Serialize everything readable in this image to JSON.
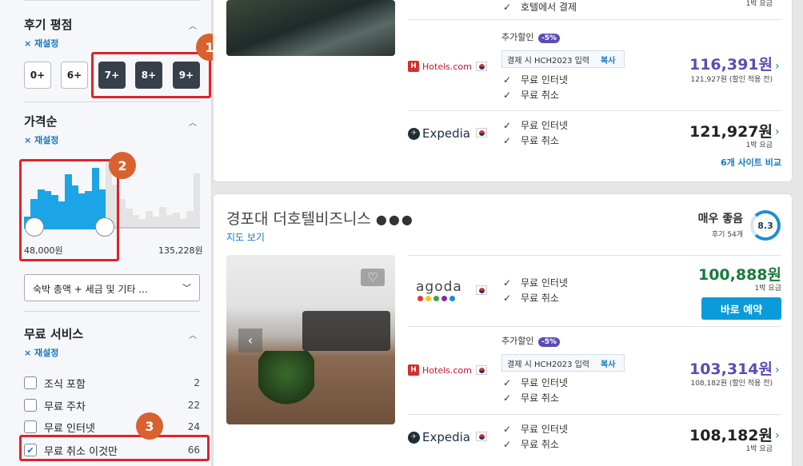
{
  "sidebar": {
    "rating": {
      "title": "후기 평점",
      "reset": "× 재설정",
      "options": [
        "0+",
        "6+",
        "7+",
        "8+",
        "9+"
      ]
    },
    "price": {
      "title": "가격순",
      "reset": "× 재설정",
      "min": "48,000원",
      "max": "135,228원",
      "select": "숙박 총액 + 세금 및 기타 ..."
    },
    "free": {
      "title": "무료 서비스",
      "reset": "× 재설정",
      "items": [
        {
          "label": "조식 포함",
          "count": "2",
          "checked": false
        },
        {
          "label": "무료 주차",
          "count": "22",
          "checked": false
        },
        {
          "label": "무료 인터넷",
          "count": "24",
          "checked": false
        },
        {
          "label": "무료 취소 이것만",
          "count": "66",
          "checked": true
        }
      ]
    }
  },
  "annotations": [
    "1",
    "2",
    "3"
  ],
  "card1": {
    "top_feature": "호텔에서 결제",
    "top_sub": "1박 요금",
    "hotels": {
      "promo": "추가할인",
      "promo_pct": "-5%",
      "coupon": "결제 시 HCH2023 입력",
      "copy": "복사",
      "features": [
        "무료 인터넷",
        "무료 취소"
      ],
      "price": "116,391원",
      "sub": "121,927원 (할인 적용 전)"
    },
    "expedia": {
      "features": [
        "무료 인터넷",
        "무료 취소"
      ],
      "price": "121,927원",
      "sub": "1박 요금"
    },
    "compare": "6개 사이트 비교"
  },
  "card2": {
    "name": "경포대 더호텔비즈니스",
    "map": "지도 보기",
    "rating_label": "매우 좋음",
    "reviews": "후기 54개",
    "score": "8.3",
    "agoda": {
      "features": [
        "무료 인터넷",
        "무료 취소"
      ],
      "price": "100,888원",
      "sub": "1박 요금",
      "book": "바로 예약"
    },
    "hotels": {
      "promo": "추가할인",
      "promo_pct": "-5%",
      "coupon": "결제 시 HCH2023 입력",
      "copy": "복사",
      "features": [
        "무료 인터넷",
        "무료 취소"
      ],
      "price": "103,314원",
      "sub": "108,182원 (할인 적용 전)"
    },
    "expedia": {
      "features": [
        "무료 인터넷",
        "무료 취소"
      ],
      "price": "108,182원",
      "sub": "1박 요금"
    }
  },
  "logos": {
    "hotels": "Hotels.com",
    "expedia": "Expedia",
    "agoda": "agoda"
  },
  "colors": {
    "accent": "#1ba5e6",
    "highlight": "#e0222b",
    "badge": "#d8612f",
    "promo_price": "#5d4bb3",
    "best_price": "#1b7a3e"
  },
  "chart_data": {
    "type": "bar",
    "title": "",
    "values": [
      12,
      30,
      40,
      38,
      34,
      28,
      55,
      44,
      36,
      38,
      62,
      40,
      70,
      45,
      30,
      20,
      14,
      10,
      18,
      12,
      22,
      14,
      16,
      10,
      18,
      56
    ],
    "highlight_count": 12
  }
}
